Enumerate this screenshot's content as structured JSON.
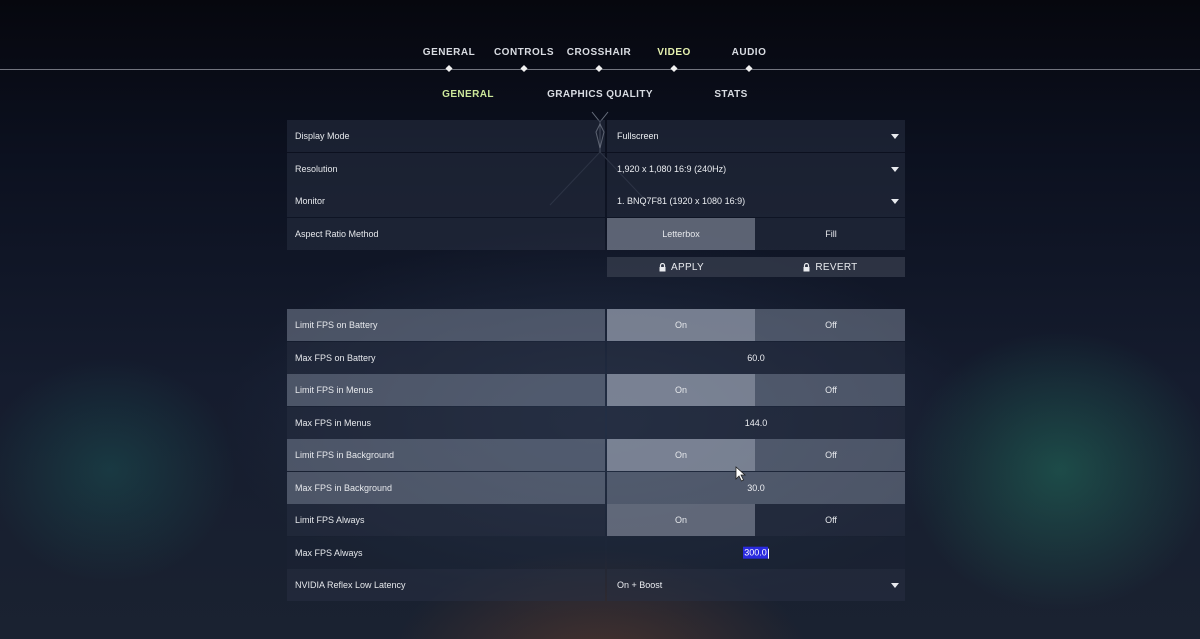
{
  "top_tabs": [
    {
      "label": "GENERAL",
      "active": false
    },
    {
      "label": "CONTROLS",
      "active": false
    },
    {
      "label": "CROSSHAIR",
      "active": false
    },
    {
      "label": "VIDEO",
      "active": true
    },
    {
      "label": "AUDIO",
      "active": false
    }
  ],
  "sub_tabs": [
    {
      "label": "GENERAL",
      "active": true
    },
    {
      "label": "GRAPHICS QUALITY",
      "active": false
    },
    {
      "label": "STATS",
      "active": false
    }
  ],
  "settings": {
    "display_mode": {
      "label": "Display Mode",
      "value": "Fullscreen"
    },
    "resolution": {
      "label": "Resolution",
      "value": "1,920 x 1,080 16:9 (240Hz)"
    },
    "monitor": {
      "label": "Monitor",
      "value": "1. BNQ7F81 (1920 x  1080 16:9)"
    },
    "aspect_ratio": {
      "label": "Aspect Ratio Method",
      "options": [
        "Letterbox",
        "Fill"
      ],
      "selected": "Letterbox"
    },
    "apply_label": "APPLY",
    "revert_label": "REVERT",
    "limit_fps_battery": {
      "label": "Limit FPS on Battery",
      "options": [
        "On",
        "Off"
      ],
      "selected": "On"
    },
    "max_fps_battery": {
      "label": "Max FPS on Battery",
      "value": "60.0"
    },
    "limit_fps_menus": {
      "label": "Limit FPS in Menus",
      "options": [
        "On",
        "Off"
      ],
      "selected": "On"
    },
    "max_fps_menus": {
      "label": "Max FPS in Menus",
      "value": "144.0"
    },
    "limit_fps_background": {
      "label": "Limit FPS in Background",
      "options": [
        "On",
        "Off"
      ],
      "selected": "On"
    },
    "max_fps_background": {
      "label": "Max FPS in Background",
      "value": "30.0"
    },
    "limit_fps_always": {
      "label": "Limit FPS Always",
      "options": [
        "On",
        "Off"
      ],
      "selected": "On"
    },
    "max_fps_always": {
      "label": "Max FPS Always",
      "value": "300.0"
    },
    "nvidia_reflex": {
      "label": "NVIDIA Reflex Low Latency",
      "value": "On + Boost"
    }
  },
  "colors": {
    "active_tab": "#e6f2b0",
    "active_subtab": "#cde89b",
    "text_selection": "#2a2adf"
  },
  "icons": [
    "chevron-down-icon",
    "lock-icon",
    "diamond-marker-icon",
    "mouse-cursor-icon"
  ]
}
